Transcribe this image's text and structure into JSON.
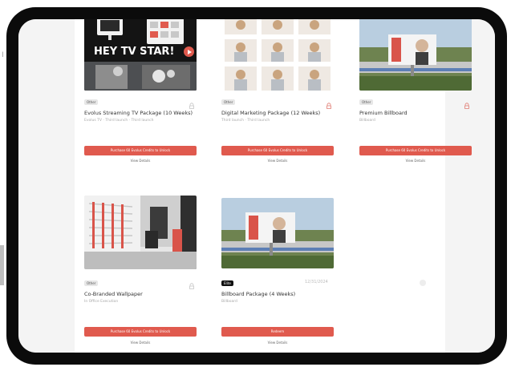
{
  "background": {
    "fragment_text": "I"
  },
  "cards": [
    {
      "badge": "Other",
      "title": "Evolus Streaming TV Package (10 Weeks)",
      "meta": "Evolus TV · Third launch · Third launch",
      "button": "Purchase 60 Evolus Credits to Unlock",
      "link": "View Details",
      "overlay_text": "HEY TV STAR!",
      "locked": true
    },
    {
      "badge": "Other",
      "title": "Digital Marketing Package (12 Weeks)",
      "meta": "Third launch · Third launch",
      "button": "Purchase 60 Evolus Credits to Unlock",
      "link": "View Details",
      "locked": true
    },
    {
      "badge": "Other",
      "title": "Premium Billboard",
      "meta": "Billboard",
      "button": "Purchase 60 Evolus Credits to Unlock",
      "link": "View Details",
      "locked": true
    },
    {
      "badge": "Other",
      "title": "Co-Branded Wallpaper",
      "meta": "In Office Execution",
      "button": "Purchase 60 Evolus Credits to Unlock",
      "link": "View Details",
      "locked": true
    },
    {
      "badge": "Elite",
      "title": "Billboard Package (4 Weeks)",
      "meta": "Billboard",
      "date": "12/31/2024",
      "button": "Redeem",
      "link": "View Details",
      "locked": false
    }
  ],
  "colors": {
    "accent": "#e05a4e",
    "frame": "#0b0b0b",
    "sidebar_grey": "#f4f4f4"
  },
  "icons": {
    "lock": "lock-icon",
    "play": "play-icon"
  }
}
